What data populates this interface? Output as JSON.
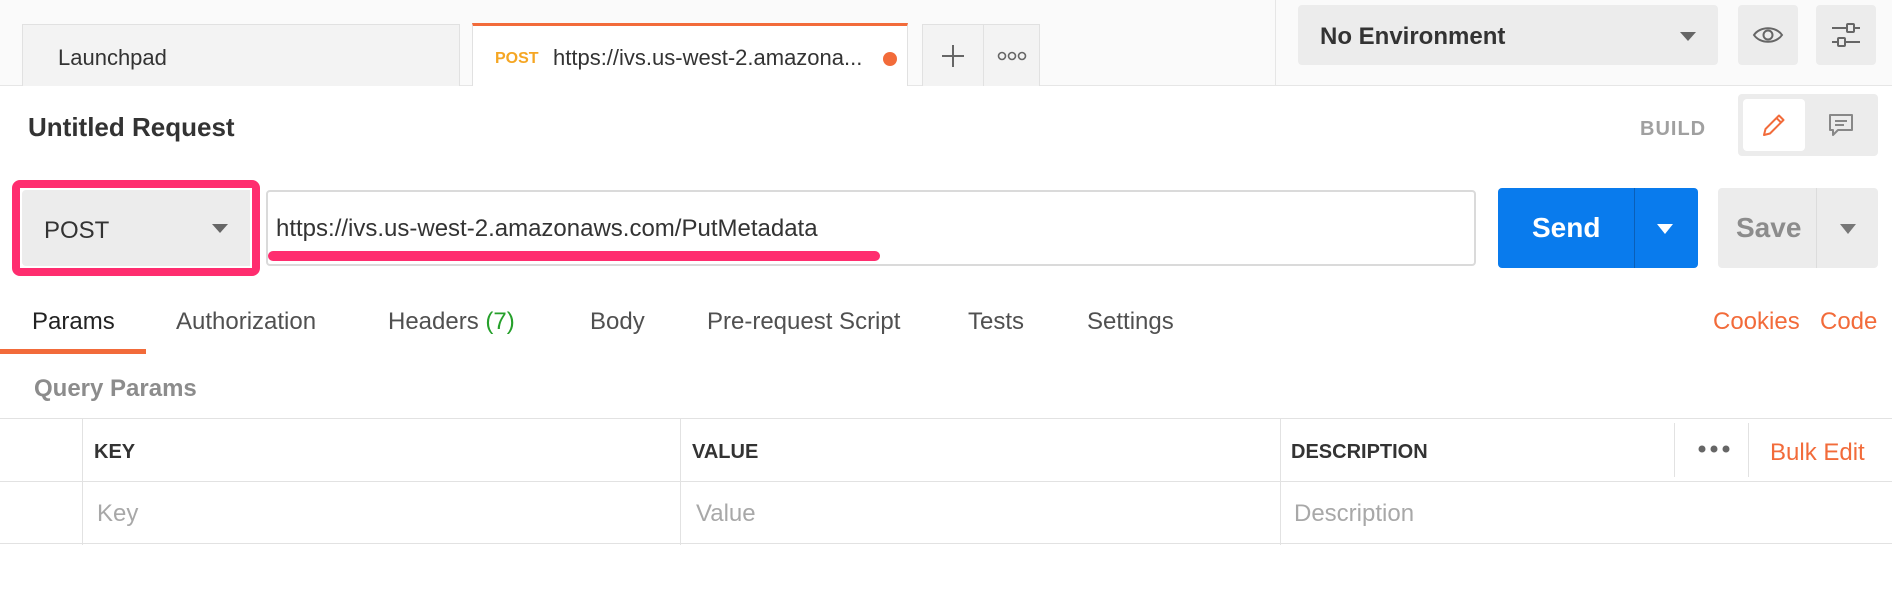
{
  "tabs": {
    "launchpad_label": "Launchpad",
    "active_method": "POST",
    "active_url": "https://ivs.us-west-2.amazona..."
  },
  "environment": {
    "selected": "No Environment"
  },
  "request": {
    "title": "Untitled Request",
    "mode_label": "BUILD",
    "method": "POST",
    "url": "https://ivs.us-west-2.amazonaws.com/PutMetadata",
    "send_label": "Send",
    "save_label": "Save"
  },
  "request_tabs": [
    {
      "label": "Params"
    },
    {
      "label": "Authorization"
    },
    {
      "label": "Headers",
      "count": "(7)"
    },
    {
      "label": "Body"
    },
    {
      "label": "Pre-request Script"
    },
    {
      "label": "Tests"
    },
    {
      "label": "Settings"
    }
  ],
  "links": {
    "cookies": "Cookies",
    "code": "Code"
  },
  "params": {
    "section_title": "Query Params",
    "columns": [
      "KEY",
      "VALUE",
      "DESCRIPTION"
    ],
    "placeholders": [
      "Key",
      "Value",
      "Description"
    ],
    "bulk_edit": "Bulk Edit"
  },
  "colors": {
    "accent": "#f26b3a",
    "send_blue": "#097bed",
    "highlight_pink": "#ff2d6f",
    "method_orange": "#f5a623",
    "count_green": "#26a02b"
  }
}
